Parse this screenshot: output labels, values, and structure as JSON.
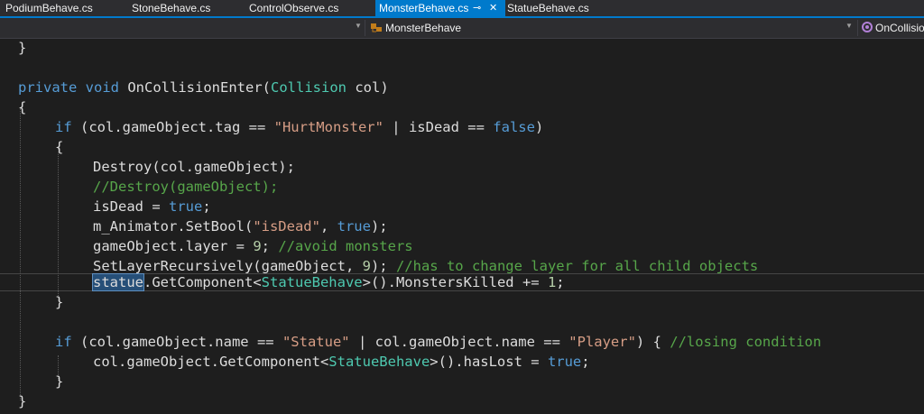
{
  "tabs": [
    {
      "label": "PodiumBehave.cs",
      "active": false
    },
    {
      "label": "StoneBehave.cs",
      "active": false
    },
    {
      "label": "ControlObserve.cs",
      "active": false
    },
    {
      "label": "MonsterBehave.cs",
      "active": true
    },
    {
      "label": "StatueBehave.cs",
      "active": false
    }
  ],
  "tab_icons": {
    "pin": "pin-icon",
    "close": "close-icon"
  },
  "nav": {
    "class_dropdown": "MonsterBehave",
    "member_dropdown": "OnCollisio",
    "class_icon": "class-icon",
    "member_icon": "method-icon"
  },
  "code": {
    "close_brace_prev": "}",
    "method_sig": {
      "kw1": "private",
      "kw2": "void",
      "name": "OnCollisionEnter",
      "open": "(",
      "type": "Collision",
      "param": " col)"
    },
    "open_brace": "{",
    "if1": {
      "kw": "if",
      "a": " (col.gameObject.tag == ",
      "str": "\"HurtMonster\"",
      "b": " | isDead == ",
      "val": "false",
      "c": ")"
    },
    "if1_open": "{",
    "l_destroy": "Destroy(col.gameObject);",
    "l_comment_destroy": "//Destroy(gameObject);",
    "l_isdead": {
      "a": "isDead = ",
      "val": "true",
      "b": ";"
    },
    "l_setbool": {
      "a": "m_Animator.SetBool(",
      "str": "\"isDead\"",
      "b": ", ",
      "val": "true",
      "c": ");"
    },
    "l_layer": {
      "a": "gameObject.layer = ",
      "num": "9",
      "b": "; ",
      "cm": "//avoid monsters"
    },
    "l_setlayer": {
      "a": "SetLayerRecursively(gameObject, ",
      "num": "9",
      "b": "); ",
      "cm": "//has to change layer for all child objects"
    },
    "l_statue": {
      "sel": "statue",
      "a": ".GetComponent<",
      "type": "StatueBehave",
      "b": ">().MonstersKilled += ",
      "num": "1",
      "c": ";"
    },
    "if1_close": "}",
    "if2": {
      "kw": "if",
      "a": " (col.gameObject.name == ",
      "str1": "\"Statue\"",
      "b": " | col.gameObject.name == ",
      "str2": "\"Player\"",
      "c": ") { ",
      "cm": "//losing condition"
    },
    "l_haslost": {
      "a": "col.gameObject.GetComponent<",
      "type": "StatueBehave",
      "b": ">().hasLost = ",
      "val": "true",
      "c": ";"
    },
    "if2_close": "}",
    "close_brace": "}"
  },
  "colors": {
    "keyword": "#569cd6",
    "type": "#4ec9b0",
    "string": "#d69d85",
    "number": "#b5cea8",
    "comment": "#57a64a",
    "text": "#dcdcdc",
    "accent": "#007acc"
  }
}
